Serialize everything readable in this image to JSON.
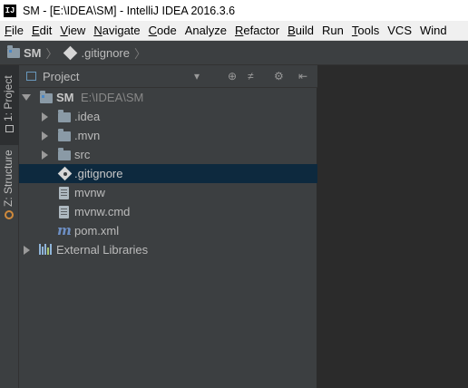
{
  "window": {
    "app_icon": "IJ",
    "title": "SM - [E:\\IDEA\\SM] - IntelliJ IDEA 2016.3.6"
  },
  "menu": [
    {
      "key": "file",
      "mn": "F",
      "rest": "ile"
    },
    {
      "key": "edit",
      "mn": "E",
      "rest": "dit"
    },
    {
      "key": "view",
      "mn": "V",
      "rest": "iew"
    },
    {
      "key": "navigate",
      "mn": "N",
      "rest": "avigate"
    },
    {
      "key": "code",
      "mn": "C",
      "rest": "ode"
    },
    {
      "key": "analyze",
      "mn": "",
      "rest": "Analyze"
    },
    {
      "key": "refactor",
      "mn": "R",
      "rest": "efactor"
    },
    {
      "key": "build",
      "mn": "B",
      "rest": "uild"
    },
    {
      "key": "run",
      "mn": "",
      "rest": "Run"
    },
    {
      "key": "tools",
      "mn": "T",
      "rest": "ools"
    },
    {
      "key": "vcs",
      "mn": "",
      "rest": "VCS"
    },
    {
      "key": "window",
      "mn": "",
      "rest": "Wind"
    }
  ],
  "breadcrumb": {
    "root": "SM",
    "current": ".gitignore",
    "separator": "〉"
  },
  "left_strip": {
    "project_tab": "1: Project",
    "structure_tab": "Z: Structure"
  },
  "project_panel": {
    "title": "Project",
    "dropdown_glyph": "▾",
    "tool_icons": {
      "locate": "⊕",
      "collapse": "≠",
      "settings": "⚙",
      "hide": "⇤"
    }
  },
  "tree": {
    "root": {
      "name": "SM",
      "path": "E:\\IDEA\\SM"
    },
    "items": [
      {
        "name": ".idea",
        "type": "folder"
      },
      {
        "name": ".mvn",
        "type": "folder"
      },
      {
        "name": "src",
        "type": "folder"
      },
      {
        "name": ".gitignore",
        "type": "gitignore",
        "selected": true
      },
      {
        "name": "mvnw",
        "type": "file"
      },
      {
        "name": "mvnw.cmd",
        "type": "file"
      },
      {
        "name": "pom.xml",
        "type": "maven"
      }
    ],
    "external": "External Libraries"
  },
  "colors": {
    "selection": "#0d293e",
    "panel_bg": "#3c3f41",
    "editor_bg": "#2b2b2b",
    "text": "#bbbbbb"
  }
}
